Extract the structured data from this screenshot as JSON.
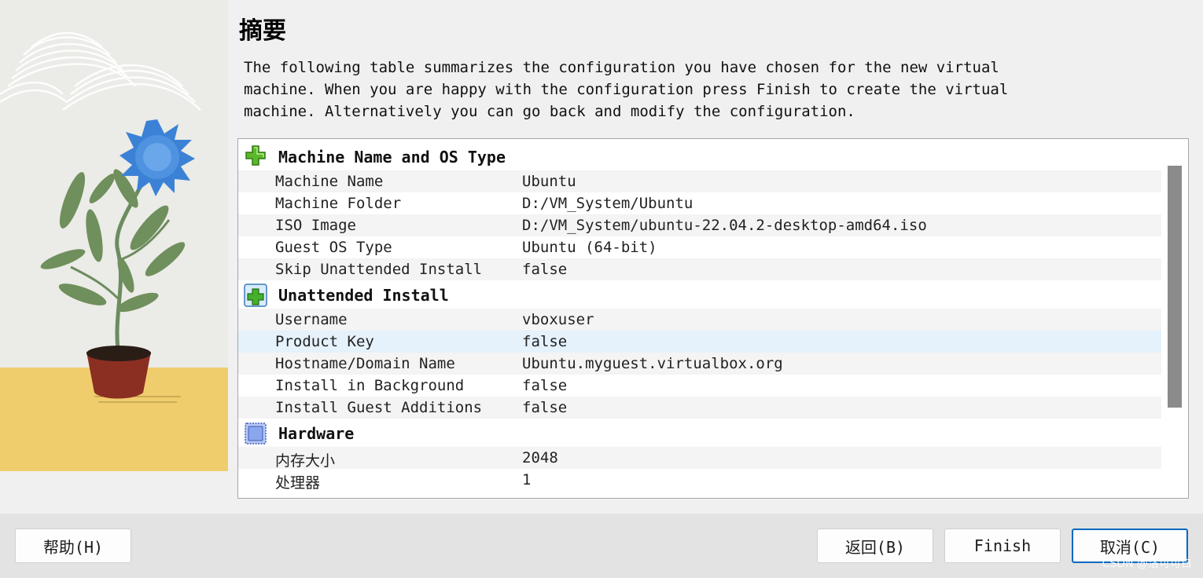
{
  "page": {
    "title": "摘要",
    "description": "The following table summarizes the configuration you have chosen for the new virtual machine. When you are happy with the configuration press Finish to create the virtual machine. Alternatively you can go back and modify the configuration."
  },
  "summary": {
    "sections": [
      {
        "title": "Machine Name and OS Type",
        "icon": "green-puzzle-icon",
        "rows": [
          {
            "key": "Machine Name",
            "value": "Ubuntu"
          },
          {
            "key": "Machine Folder",
            "value": "D:/VM_System/Ubuntu"
          },
          {
            "key": "ISO Image",
            "value": "D:/VM_System/ubuntu-22.04.2-desktop-amd64.iso"
          },
          {
            "key": "Guest OS Type",
            "value": "Ubuntu (64-bit)"
          },
          {
            "key": "Skip Unattended Install",
            "value": "false"
          }
        ]
      },
      {
        "title": "Unattended Install",
        "icon": "green-plus-icon",
        "rows": [
          {
            "key": "Username",
            "value": "vboxuser"
          },
          {
            "key": "Product Key",
            "value": "false"
          },
          {
            "key": "Hostname/Domain Name",
            "value": "Ubuntu.myguest.virtualbox.org"
          },
          {
            "key": "Install in Background",
            "value": "false"
          },
          {
            "key": "Install Guest Additions",
            "value": "false"
          }
        ]
      },
      {
        "title": "Hardware",
        "icon": "chip-icon",
        "rows": [
          {
            "key": "内存大小",
            "value": "2048"
          },
          {
            "key": "处理器",
            "value": "1"
          }
        ]
      }
    ],
    "selected_row": "Product Key"
  },
  "buttons": {
    "help": "帮助(H)",
    "back": "返回(B)",
    "finish": "Finish",
    "cancel": "取消(C)"
  },
  "watermark": "CSDN @洛可可白",
  "colors": {
    "selected_row": "#e5f1fb",
    "alt_row": "#f4f4f4",
    "default_button_border": "#0067c0",
    "floor_yellow": "#f0cd6c",
    "flower_blue": "#3b82d6"
  }
}
